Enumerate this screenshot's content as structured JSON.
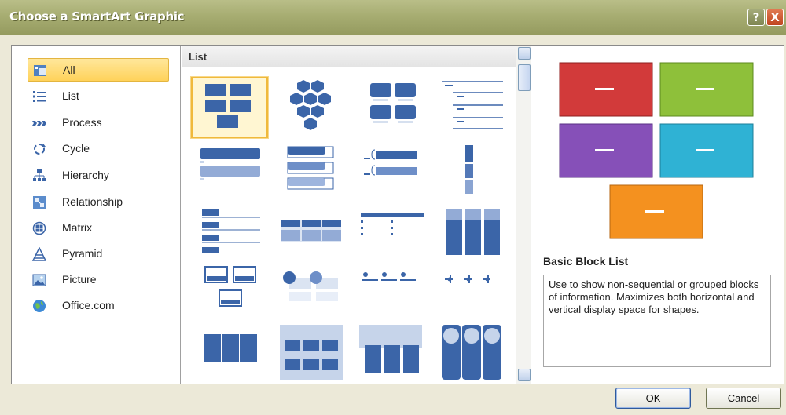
{
  "window": {
    "title": "Choose a SmartArt Graphic",
    "help_label": "?",
    "close_label": "X"
  },
  "categories": [
    {
      "label": "All",
      "icon": "all-icon",
      "selected": true
    },
    {
      "label": "List",
      "icon": "list-icon"
    },
    {
      "label": "Process",
      "icon": "process-icon"
    },
    {
      "label": "Cycle",
      "icon": "cycle-icon"
    },
    {
      "label": "Hierarchy",
      "icon": "hierarchy-icon"
    },
    {
      "label": "Relationship",
      "icon": "relationship-icon"
    },
    {
      "label": "Matrix",
      "icon": "matrix-icon"
    },
    {
      "label": "Pyramid",
      "icon": "pyramid-icon"
    },
    {
      "label": "Picture",
      "icon": "picture-icon"
    },
    {
      "label": "Office.com",
      "icon": "globe-icon"
    }
  ],
  "layouts": {
    "header": "List",
    "selected_index": 0
  },
  "preview": {
    "title": "Basic Block List",
    "description": "Use to show non-sequential or grouped blocks of information. Maximizes both horizontal and vertical display space for shapes.",
    "block_colors": [
      "#d23a3a",
      "#8ec03a",
      "#8650b8",
      "#2fb2d4",
      "#f4911f"
    ]
  },
  "buttons": {
    "ok": "OK",
    "cancel": "Cancel"
  },
  "colors": {
    "accent_blue": "#3b65a8",
    "light_blue": "#bfcfe8",
    "selection": "#f0b93b"
  }
}
